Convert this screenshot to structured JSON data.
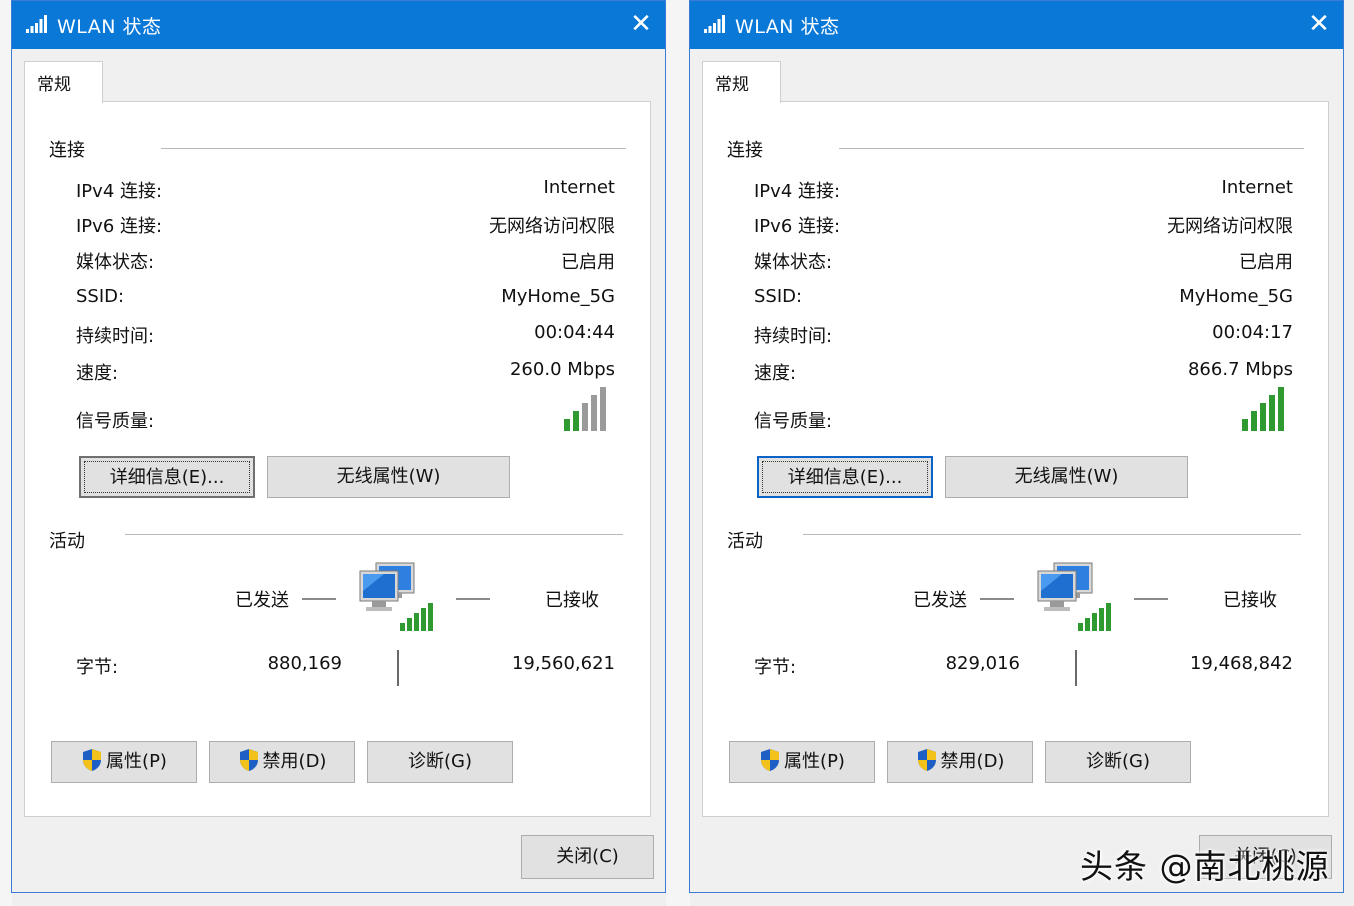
{
  "watermark": "头条 @南北桃源",
  "dialogs": [
    {
      "title": "WLAN 状态",
      "close_glyph": "✕",
      "tab": "常规",
      "connection": {
        "label": "连接",
        "rows": [
          {
            "label": "IPv4 连接:",
            "value": "Internet"
          },
          {
            "label": "IPv6 连接:",
            "value": "无网络访问权限"
          },
          {
            "label": "媒体状态:",
            "value": "已启用"
          },
          {
            "label": "SSID:",
            "value": "MyHome_5G"
          },
          {
            "label": "持续时间:",
            "value": "00:04:44"
          },
          {
            "label": "速度:",
            "value": "260.0 Mbps"
          }
        ],
        "signal_label": "信号质量:",
        "signal_bars_filled": 2,
        "signal_bars_total": 5
      },
      "details_button": "详细信息(E)...",
      "wireless_button": "无线属性(W)",
      "activity": {
        "label": "活动",
        "sent_label": "已发送",
        "received_label": "已接收",
        "bytes_label": "字节:",
        "bytes_sent": "880,169",
        "bytes_received": "19,560,621"
      },
      "properties_button": "属性(P)",
      "disable_button": "禁用(D)",
      "diagnose_button": "诊断(G)",
      "close_button": "关闭(C)"
    },
    {
      "title": "WLAN 状态",
      "close_glyph": "✕",
      "tab": "常规",
      "connection": {
        "label": "连接",
        "rows": [
          {
            "label": "IPv4 连接:",
            "value": "Internet"
          },
          {
            "label": "IPv6 连接:",
            "value": "无网络访问权限"
          },
          {
            "label": "媒体状态:",
            "value": "已启用"
          },
          {
            "label": "SSID:",
            "value": "MyHome_5G"
          },
          {
            "label": "持续时间:",
            "value": "00:04:17"
          },
          {
            "label": "速度:",
            "value": "866.7 Mbps"
          }
        ],
        "signal_label": "信号质量:",
        "signal_bars_filled": 5,
        "signal_bars_total": 5
      },
      "details_button": "详细信息(E)...",
      "wireless_button": "无线属性(W)",
      "activity": {
        "label": "活动",
        "sent_label": "已发送",
        "received_label": "已接收",
        "bytes_label": "字节:",
        "bytes_sent": "829,016",
        "bytes_received": "19,468,842"
      },
      "properties_button": "属性(P)",
      "disable_button": "禁用(D)",
      "diagnose_button": "诊断(G)",
      "close_button": "关闭(C)"
    }
  ],
  "colors": {
    "titlebar": "#0a78d7",
    "signal_on": "#2f9a2f",
    "signal_off": "#9a9a9a"
  },
  "icons": {
    "title": "wifi-signal-icon",
    "close": "close-icon",
    "activity": "network-computers-icon",
    "shield": "uac-shield-icon"
  }
}
